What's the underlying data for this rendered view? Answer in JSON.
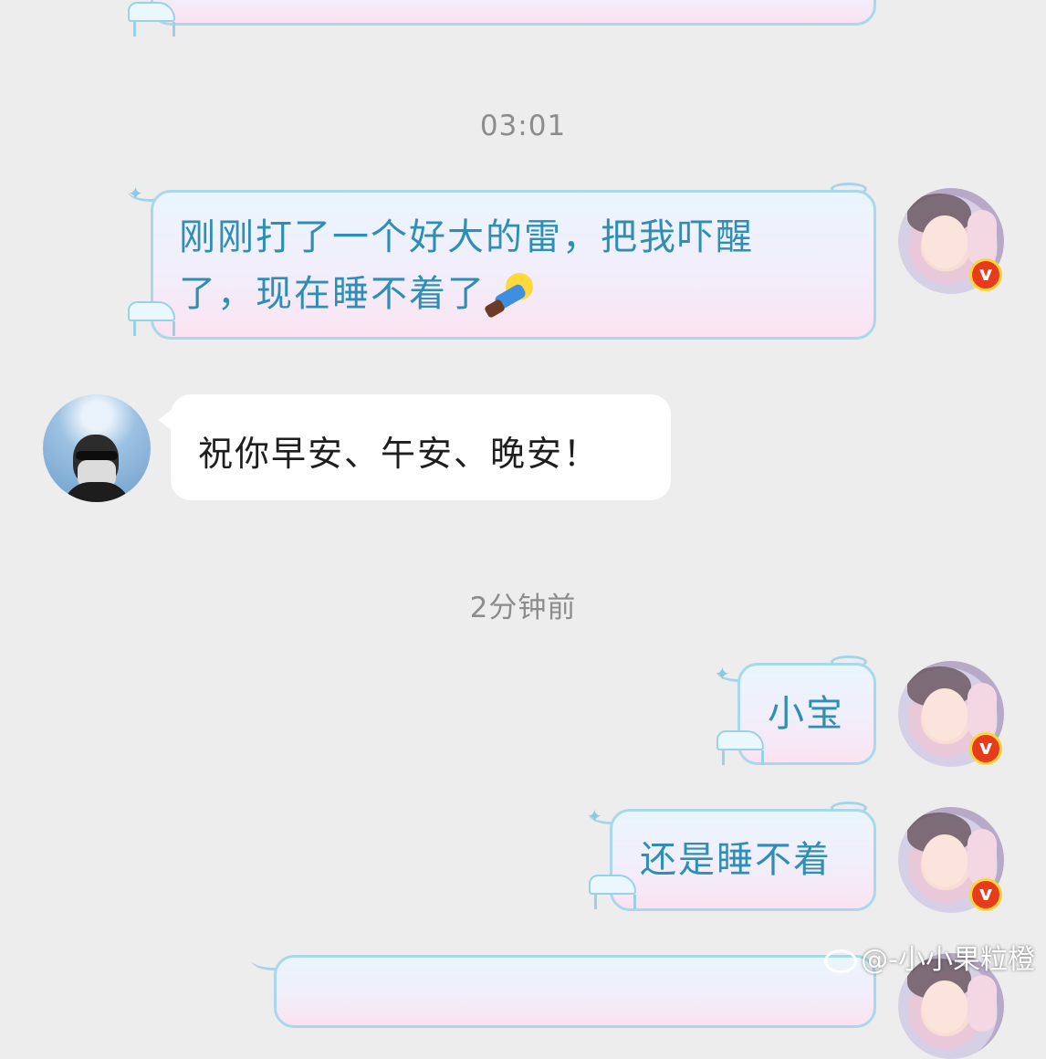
{
  "timestamps": [
    "03:01",
    "2分钟前"
  ],
  "messages": [
    {
      "side": "right",
      "line1": "刚刚打了一个好大的雷，把我吓醒",
      "line2": "了，现在睡不着了",
      "emoji_icon": "person-lying-down-emoji"
    },
    {
      "side": "left",
      "text": "祝你早安、午安、晚安！"
    },
    {
      "side": "right",
      "text": "小宝"
    },
    {
      "side": "right",
      "text": "还是睡不着"
    }
  ],
  "avatar_badge": "v",
  "watermark": "@-小小果粒橙",
  "colors": {
    "background": "#ededed",
    "bubble_text": "#2f8eb4",
    "bubble_border": "#a9d8ec",
    "badge": "#e83b1b"
  }
}
